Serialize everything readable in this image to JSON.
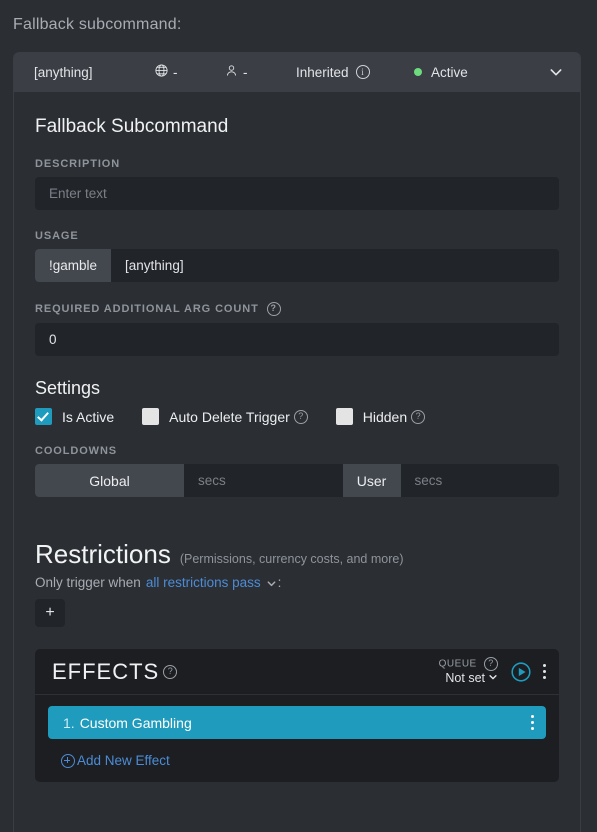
{
  "page": {
    "top_label": "Fallback subcommand:"
  },
  "command_header": {
    "trigger": "[anything]",
    "globe_icon": "globe-icon",
    "globe_value": "-",
    "user_icon": "person-icon",
    "user_value": "-",
    "inherited_label": "Inherited",
    "inherited_info_icon": "info-icon",
    "status_label": "Active",
    "status_color": "#6ddb7e",
    "collapse_icon": "chevron-down-icon"
  },
  "form": {
    "heading": "Fallback Subcommand",
    "description": {
      "label": "DESCRIPTION",
      "value": "",
      "placeholder": "Enter text"
    },
    "usage": {
      "label": "USAGE",
      "prefix": "!gamble",
      "value": "[anything]"
    },
    "arg_count": {
      "label": "REQUIRED ADDITIONAL ARG COUNT",
      "help_icon": "question-icon",
      "value": "0"
    }
  },
  "settings": {
    "title": "Settings",
    "checkboxes": [
      {
        "label": "Is Active",
        "checked": true,
        "help": false
      },
      {
        "label": "Auto Delete Trigger",
        "checked": false,
        "help": true
      },
      {
        "label": "Hidden",
        "checked": false,
        "help": true
      }
    ]
  },
  "cooldowns": {
    "label": "COOLDOWNS",
    "global_label": "Global",
    "global_value": "",
    "global_placeholder": "secs",
    "user_label": "User",
    "user_value": "",
    "user_placeholder": "secs"
  },
  "restrictions": {
    "title": "Restrictions",
    "subtitle": "(Permissions, currency costs, and more)",
    "prefix_text": "Only trigger when",
    "mode": "all restrictions pass",
    "suffix_text": ":",
    "add_button": "+"
  },
  "effects": {
    "title": "EFFECTS",
    "title_help_icon": "question-icon",
    "queue_label": "QUEUE",
    "queue_help_icon": "question-icon",
    "queue_value": "Not set",
    "play_icon": "play-circle-icon",
    "menu_icon": "kebab-menu-icon",
    "accent_color": "#1e9bbd",
    "list": [
      {
        "index": "1.",
        "name": "Custom Gambling"
      }
    ],
    "add_link": "Add New Effect"
  }
}
